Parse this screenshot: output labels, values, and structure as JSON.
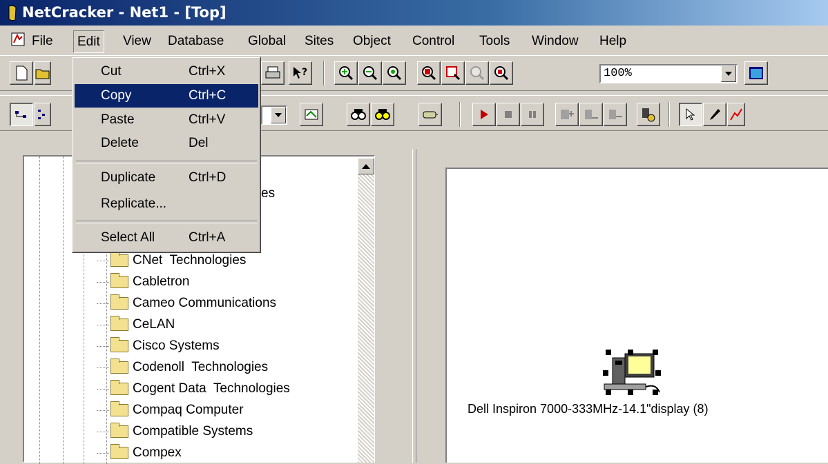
{
  "window": {
    "title": "NetCracker - Net1 - [Top]"
  },
  "menu": [
    "File",
    "Edit",
    "View",
    "Database",
    "Global",
    "Sites",
    "Object",
    "Control",
    "Tools",
    "Window",
    "Help"
  ],
  "edit_menu": {
    "items": [
      {
        "label": "Cut",
        "shortcut": "Ctrl+X"
      },
      {
        "label": "Copy",
        "shortcut": "Ctrl+C",
        "highlighted": true
      },
      {
        "label": "Paste",
        "shortcut": "Ctrl+V"
      },
      {
        "label": "Delete",
        "shortcut": "Del"
      },
      {
        "label": "Duplicate",
        "shortcut": "Ctrl+D"
      },
      {
        "label": "Replicate...",
        "shortcut": ""
      },
      {
        "label": "Select All",
        "shortcut": "Ctrl+A"
      }
    ]
  },
  "toolbar": {
    "zoom_value": "100%"
  },
  "tree": {
    "partial_label": "es",
    "items": [
      "CNet  Technologies",
      "Cabletron",
      "Cameo Communications",
      "CeLAN",
      "Cisco Systems",
      "Codenoll  Technologies",
      "Cogent Data  Technologies",
      "Compaq Computer",
      "Compatible Systems",
      "Compex"
    ]
  },
  "canvas": {
    "device_label": "Dell Inspiron 7000-333MHz-14.1\"display (8)"
  },
  "colors": {
    "title_bar": "#0a246a",
    "menu_highlight": "#0a246a",
    "face": "#d4d0c8"
  }
}
